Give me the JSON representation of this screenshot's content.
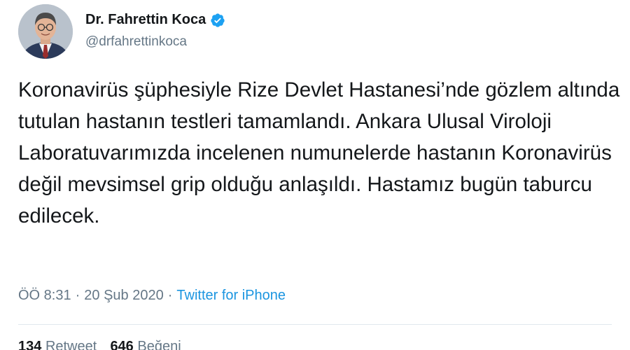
{
  "author": {
    "display_name": "Dr. Fahrettin Koca",
    "handle": "@drfahrettinkoca",
    "verified_icon": "verified-badge-icon",
    "avatar": "avatar-photo"
  },
  "tweet": {
    "text": "Koronavirüs şüphesiyle Rize Devlet Hastanesi’nde gözlem altında tutulan hastanın testleri tamamlandı. Ankara Ulusal Viroloji Laboratuvarımızda incelenen numunelerde hastanın Koronavirüs değil mevsimsel grip olduğu anlaşıldı. Hastamız bugün taburcu edilecek."
  },
  "meta": {
    "time": "ÖÖ 8:31",
    "sep1": "·",
    "date": "20 Şub 2020",
    "sep2": "·",
    "source": "Twitter for iPhone"
  },
  "stats": {
    "retweets_count": "134",
    "retweets_label": "Retweet",
    "likes_count": "646",
    "likes_label": "Beğeni"
  },
  "colors": {
    "accent": "#1b95e0",
    "secondary_text": "#657786",
    "primary_text": "#14171a"
  }
}
